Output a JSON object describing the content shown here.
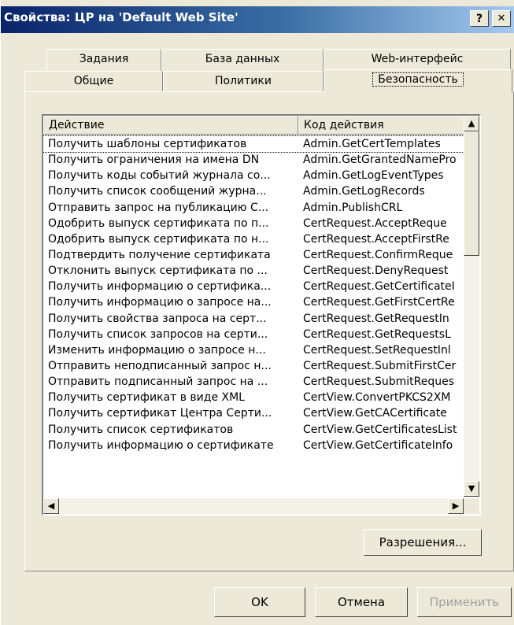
{
  "window": {
    "title": "Свойства: ЦР на 'Default Web Site'",
    "help_label": "?",
    "close_label": "✕"
  },
  "tabs": {
    "top": [
      "Задания",
      "База данных",
      "Web-интерфейс"
    ],
    "bottom": [
      "Общие",
      "Политики",
      "Безопасность"
    ],
    "active": "Безопасность"
  },
  "list": {
    "headers": [
      "Действие",
      "Код действия"
    ],
    "rows": [
      [
        "Получить шаблоны сертификатов",
        "Admin.GetCertTemplates"
      ],
      [
        "Получить ограничения на имена DN",
        "Admin.GetGrantedNamePro"
      ],
      [
        "Получить коды событий журнала со...",
        "Admin.GetLogEventTypes"
      ],
      [
        "Получить список сообщений журна...",
        "Admin.GetLogRecords"
      ],
      [
        "Отправить запрос на публикацию С...",
        "Admin.PublishCRL"
      ],
      [
        "Одобрить выпуск сертификата по п...",
        "CertRequest.AcceptReque"
      ],
      [
        "Одобрить выпуск сертификата по н...",
        "CertRequest.AcceptFirstRe"
      ],
      [
        "Подтвердить получение сертификата",
        "CertRequest.ConfirmReque"
      ],
      [
        "Отклонить выпуск сертификата по ...",
        "CertRequest.DenyRequest"
      ],
      [
        "Получить информацию о сертифика...",
        "CertRequest.GetCertificateI"
      ],
      [
        "Получить информацию о запросе на...",
        "CertRequest.GetFirstCertRe"
      ],
      [
        "Получить свойства запроса на серт...",
        "CertRequest.GetRequestIn"
      ],
      [
        "Получить список запросов на серти...",
        "CertRequest.GetRequestsL"
      ],
      [
        "Изменить информацию о запросе н...",
        "CertRequest.SetRequestInl"
      ],
      [
        "Отправить неподписанный запрос н...",
        "CertRequest.SubmitFirstCer"
      ],
      [
        "Отправить подписанный запрос на ...",
        "CertRequest.SubmitReques"
      ],
      [
        "Получить сертификат в виде XML",
        "CertView.ConvertPKCS2XM"
      ],
      [
        "Получить сертификат Центра Серти...",
        "CertView.GetCACertificate"
      ],
      [
        "Получить список сертификатов",
        "CertView.GetCertificatesList"
      ],
      [
        "Получить информацию о сертификате",
        "CertView.GetCertificateInfo"
      ]
    ],
    "selected_row": 0
  },
  "buttons": {
    "permissions": "Разрешения...",
    "ok": "OK",
    "cancel": "Отмена",
    "apply": "Применить"
  },
  "scroll": {
    "up": "▲",
    "down": "▼",
    "left": "◀",
    "right": "▶"
  }
}
